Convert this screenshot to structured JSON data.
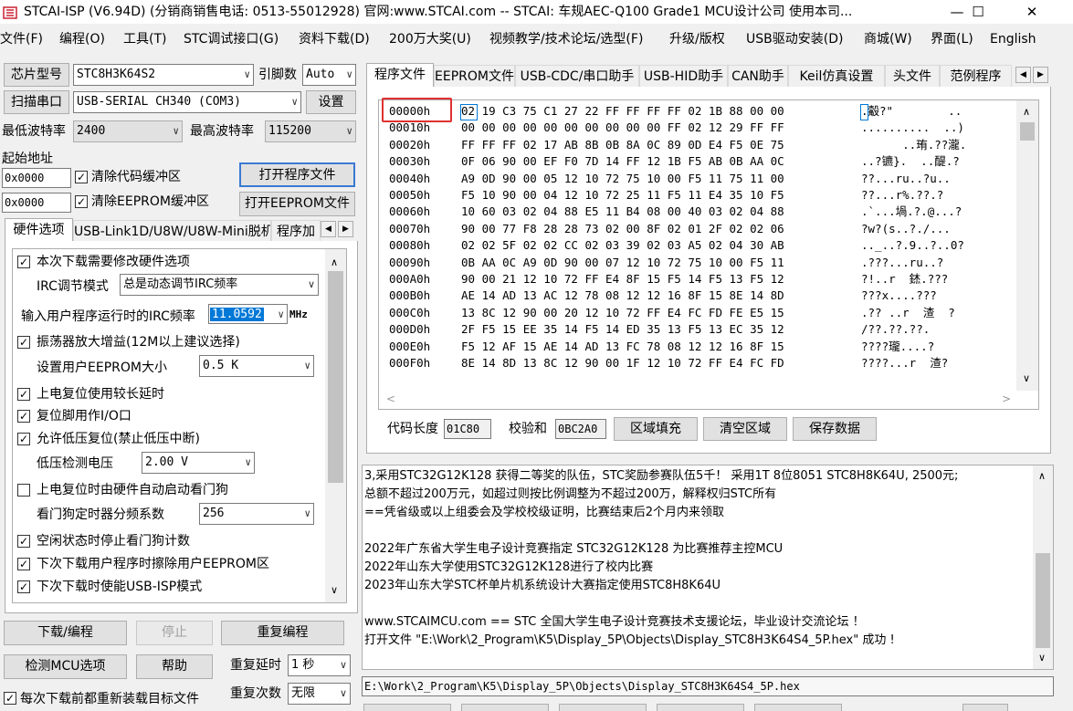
{
  "window": {
    "title": "STCAI-ISP (V6.94D) (分销商销售电话: 0513-55012928) 官网:www.STCAI.com  -- STCAI: 车规AEC-Q100 Grade1 MCU设计公司 使用本司...",
    "minimize": "—",
    "maximize": "☐",
    "close": "✕"
  },
  "menu": [
    "文件(F)",
    "编程(O)",
    "工具(T)",
    "STC调试接口(G)",
    "资料下载(D)",
    "200万大奖(U)",
    "视频教学/技术论坛/选型(F)",
    "升级/版权",
    "USB驱动安装(D)",
    "商城(W)",
    "界面(L)",
    "English"
  ],
  "left": {
    "chip_label": "芯片型号",
    "chip_value": "STC8H3K64S2",
    "pin_label": "引脚数",
    "pin_value": "Auto",
    "scan_button": "扫描串口",
    "port_value": "USB-SERIAL CH340 (COM3)",
    "settings_button": "设置",
    "min_baud_label": "最低波特率",
    "min_baud_value": "2400",
    "max_baud_label": "最高波特率",
    "max_baud_value": "115200",
    "start_addr_label": "起始地址",
    "addr1": "0x0000",
    "clear_code_label": "清除代码缓冲区",
    "open_program_button": "打开程序文件",
    "addr2": "0x0000",
    "clear_eeprom_label": "清除EEPROM缓冲区",
    "open_eeprom_button": "打开EEPROM文件",
    "hw_tabs": [
      "硬件选项",
      "USB-Link1D/U8W/U8W-Mini脱机",
      "程序加"
    ],
    "options": {
      "modify_hw": "本次下载需要修改硬件选项",
      "irc_mode_label": "IRC调节模式",
      "irc_mode_value": "总是动态调节IRC频率",
      "irc_freq_label": "输入用户程序运行时的IRC频率",
      "irc_freq_value": "11.0592",
      "irc_freq_unit": "MHz",
      "osc_gain": "振荡器放大增益(12M以上建议选择)",
      "eeprom_size_label": "设置用户EEPROM大小",
      "eeprom_size_value": "0.5 K",
      "power_on_delay": "上电复位使用较长延时",
      "reset_pin_io": "复位脚用作I/O口",
      "low_voltage_reset": "允许低压复位(禁止低压中断)",
      "lv_detect_label": "低压检测电压",
      "lv_detect_value": "2.00 V",
      "wdt_auto": "上电复位时由硬件自动启动看门狗",
      "wdt_div_label": "看门狗定时器分频系数",
      "wdt_div_value": "256",
      "idle_stop_wdt": "空闲状态时停止看门狗计数",
      "erase_eeprom": "下次下载用户程序时擦除用户EEPROM区",
      "enable_usb_isp": "下次下载时使能USB-ISP模式"
    },
    "download_button": "下载/编程",
    "stop_button": "停止",
    "reprogram_button": "重复编程",
    "check_mcu_button": "检测MCU选项",
    "help_button": "帮助",
    "repeat_delay_label": "重复延时",
    "repeat_delay_value": "1 秒",
    "repeat_count_label": "重复次数",
    "repeat_count_value": "无限",
    "reload_label": "每次下载前都重新装载目标文件"
  },
  "right": {
    "tabs": [
      "程序文件",
      "EEPROM文件",
      "USB-CDC/串口助手",
      "USB-HID助手",
      "CAN助手",
      "Keil仿真设置",
      "头文件",
      "范例程序"
    ],
    "hex_rows": [
      {
        "addr": "00000h",
        "bytes": "02 19 C3 75 C1 27 22 FF FF FF FF 02 1B 88 00 00",
        "ascii": ".觳?\"        .."
      },
      {
        "addr": "00010h",
        "bytes": "00 00 00 00 00 00 00 00 00 00 FF 02 12 29 FF FF",
        "ascii": "..........  ..)"
      },
      {
        "addr": "00020h",
        "bytes": "FF FF FF 02 17 AB 8B 0B 8A 0C 89 0D E4 F5 0E 75",
        "ascii": "      ..珛.??瀧."
      },
      {
        "addr": "00030h",
        "bytes": "0F 06 90 00 EF F0 7D 14 FF 12 1B F5 AB 0B AA 0C",
        "ascii": "..?镳}.  ..醍.?"
      },
      {
        "addr": "00040h",
        "bytes": "A9 0D 90 00 05 12 10 72 75 10 00 F5 11 75 11 00",
        "ascii": "??...ru..?u.."
      },
      {
        "addr": "00050h",
        "bytes": "F5 10 90 00 04 12 10 72 25 11 F5 11 E4 35 10 F5",
        "ascii": "??...r%.??.?"
      },
      {
        "addr": "00060h",
        "bytes": "10 60 03 02 04 88 E5 11 B4 08 00 40 03 02 04 88",
        "ascii": ".`...堝.?.@...?"
      },
      {
        "addr": "00070h",
        "bytes": "90 00 77 F8 28 28 73 02 00 8F 02 01 2F 02 02 06",
        "ascii": "?w?(s..?./..."
      },
      {
        "addr": "00080h",
        "bytes": "02 02 5F 02 02 CC 02 03 39 02 03 A5 02 04 30 AB",
        "ascii": ".._..?.9..?..0?"
      },
      {
        "addr": "00090h",
        "bytes": "0B AA 0C A9 0D 90 00 07 12 10 72 75 10 00 F5 11",
        "ascii": ".???...ru..?"
      },
      {
        "addr": "000A0h",
        "bytes": "90 00 21 12 10 72 FF E4 8F 15 F5 14 F5 13 F5 12",
        "ascii": "?!..r  錰.???"
      },
      {
        "addr": "000B0h",
        "bytes": "AE 14 AD 13 AC 12 78 08 12 12 16 8F 15 8E 14 8D",
        "ascii": "???x....???"
      },
      {
        "addr": "000C0h",
        "bytes": "13 8C 12 90 00 20 12 10 72 FF E4 FC FD FE E5 15",
        "ascii": ".?? ..r  渣  ?"
      },
      {
        "addr": "000D0h",
        "bytes": "2F F5 15 EE 35 14 F5 14 ED 35 13 F5 13 EC 35 12",
        "ascii": "/??.??.??."
      },
      {
        "addr": "000E0h",
        "bytes": "F5 12 AF 15 AE 14 AD 13 FC 78 08 12 12 16 8F 15",
        "ascii": "????瓏....?"
      },
      {
        "addr": "000F0h",
        "bytes": "8E 14 8D 13 8C 12 90 00 1F 12 10 72 FF E4 FC FD",
        "ascii": "????...r  渣?"
      }
    ],
    "code_len_label": "代码长度",
    "code_len_value": "01C80",
    "checksum_label": "校验和",
    "checksum_value": "0BC2A0",
    "fill_button": "区域填充",
    "clear_button": "清空区域",
    "save_button": "保存数据",
    "log_lines": [
      "3,采用STC32G12K128 获得二等奖的队伍，STC奖励参赛队伍5千！ 采用1T 8位8051 STC8H8K64U, 2500元;",
      "总额不超过200万元，如超过则按比例调整为不超过200万，解释权归STC所有",
      "==凭省级或以上组委会及学校校级证明，比赛结束后2个月内来领取",
      "",
      "2022年广东省大学生电子设计竞赛指定 STC32G12K128 为比赛推荐主控MCU",
      "2022年山东大学使用STC32G12K128进行了校内比赛",
      "2023年山东大学STC杯单片机系统设计大赛指定使用STC8H8K64U",
      "",
      "www.STCAIMCU.com == STC 全国大学生电子设计竞赛技术支援论坛，毕业设计交流论坛 ！",
      "打开文件 \"E:\\Work\\2_Program\\K5\\Display_5P\\Objects\\Display_STC8H3K64S4_5P.hex\" 成功 !"
    ],
    "path": "E:\\Work\\2_Program\\K5\\Display_5P\\Objects\\Display_STC8H3K64S4_5P.hex"
  },
  "colors": {
    "highlight_box": "#e03030",
    "selection": "#0078d7",
    "tab_border": "#adadad"
  }
}
